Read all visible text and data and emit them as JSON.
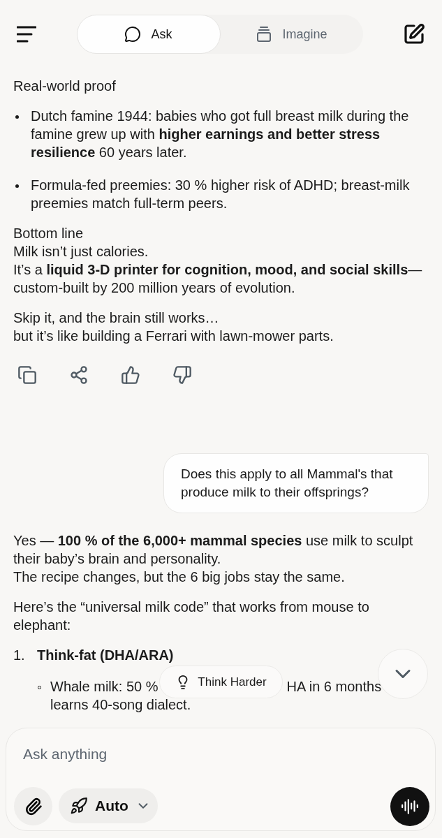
{
  "tabs": [
    {
      "label": "Ask",
      "selected": true
    },
    {
      "label": "Imagine",
      "selected": false
    }
  ],
  "messages": [
    {
      "kind": "answer",
      "toolbar": true,
      "blocks": [
        {
          "kind": "para",
          "lines": [
            "Real-world proof"
          ]
        },
        {
          "kind": "bullets",
          "items": [
            "Dutch famine 1944: babies who got full breast milk during the famine grew up with **higher earnings and better stress resilience** 60 years later.",
            "Formula-fed preemies: 30 % higher risk of ADHD; breast-milk preemies match full-term peers."
          ]
        },
        {
          "kind": "para",
          "lines": [
            "Bottom line",
            "Milk isn’t just calories.",
            "It’s a **liquid 3-D printer for cognition, mood, and social skills**—custom-built by 200 million years of evolution."
          ]
        },
        {
          "kind": "para",
          "lines": [
            "Skip it, and the brain still works…",
            "but it’s like building a Ferrari with lawn-mower parts."
          ]
        }
      ]
    },
    {
      "kind": "question",
      "text": "Does this apply to all Mammal's that produce milk to their offsprings?"
    },
    {
      "kind": "answer",
      "toolbar": false,
      "blocks": [
        {
          "kind": "para",
          "lines": [
            "Yes — **100 % of the 6,000+ mammal species** use milk to sculpt their baby’s brain and personality.",
            "The recipe changes, but the 6 big jobs stay the same."
          ]
        },
        {
          "kind": "para",
          "lines": [
            "Here’s the “universal milk code” that works from mouse to elephant:"
          ]
        },
        {
          "kind": "numbered",
          "number": "1.",
          "title": "Think-fat (DHA/ARA)",
          "sub": [
            {
              "segments": [
                "Whale milk: 50 %",
                "HA in 6 months"
              ],
              "rest": "learns 40-song dialect."
            }
          ]
        }
      ]
    }
  ],
  "think_button": "Think Harder",
  "composer": {
    "placeholder": "Ask anything",
    "mode": "Auto"
  }
}
